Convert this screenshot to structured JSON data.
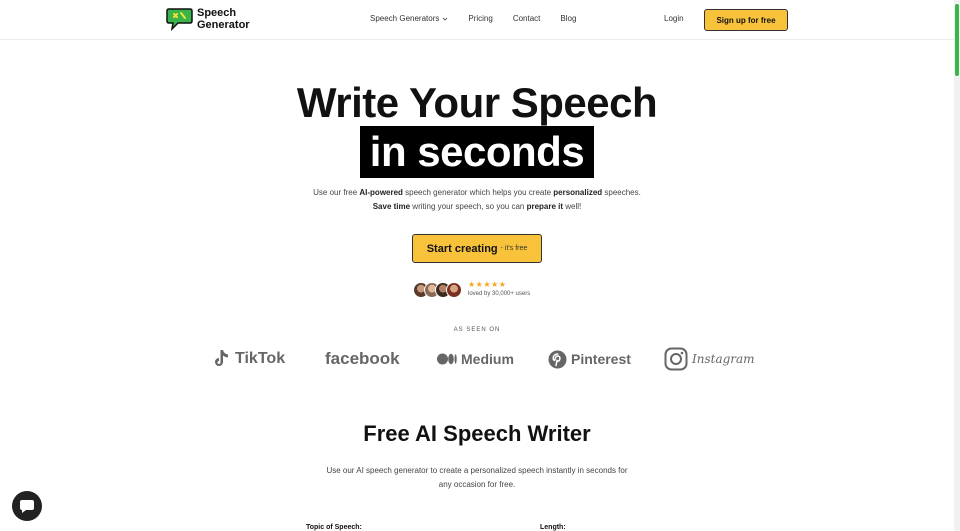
{
  "header": {
    "logo_line1": "Speech",
    "logo_line2": "Generator",
    "nav": [
      {
        "label": "Speech Generators",
        "has_dropdown": true
      },
      {
        "label": "Pricing"
      },
      {
        "label": "Contact"
      },
      {
        "label": "Blog"
      }
    ],
    "login_label": "Login",
    "signup_label": "Sign up for free"
  },
  "hero": {
    "title_line1": "Write Your Speech",
    "title_highlight": "in seconds",
    "sub_line1_a": "Use our free ",
    "sub_line1_b": "AI-powered",
    "sub_line1_c": " speech generator which helps you create ",
    "sub_line1_d": "personalized",
    "sub_line1_e": " speeches.",
    "sub_line2_a": "Save time",
    "sub_line2_b": " writing your speech, so you can ",
    "sub_line2_c": "prepare it",
    "sub_line2_d": " well!",
    "cta_main": "Start creating",
    "cta_sub": "- it's free",
    "stars": "★★★★★",
    "loved_by": "loved by 30,000+ users"
  },
  "as_seen_on": {
    "label": "AS SEEN ON",
    "brands": [
      "TikTok",
      "facebook",
      "Medium",
      "Pinterest",
      "Instagram"
    ]
  },
  "writer": {
    "title": "Free AI Speech Writer",
    "desc_line1": "Use our AI speech generator to create a personalized speech instantly in seconds for",
    "desc_line2": "any occasion for free.",
    "topic_label": "Topic of Speech:",
    "length_label": "Length:"
  },
  "colors": {
    "accent": "#f8c33a",
    "logo_green": "#3ab54a",
    "text": "#111111",
    "brand_gray": "#666666"
  },
  "icons": {
    "logo": "speech-bubble-icon",
    "chat": "chat-bubble-icon"
  }
}
